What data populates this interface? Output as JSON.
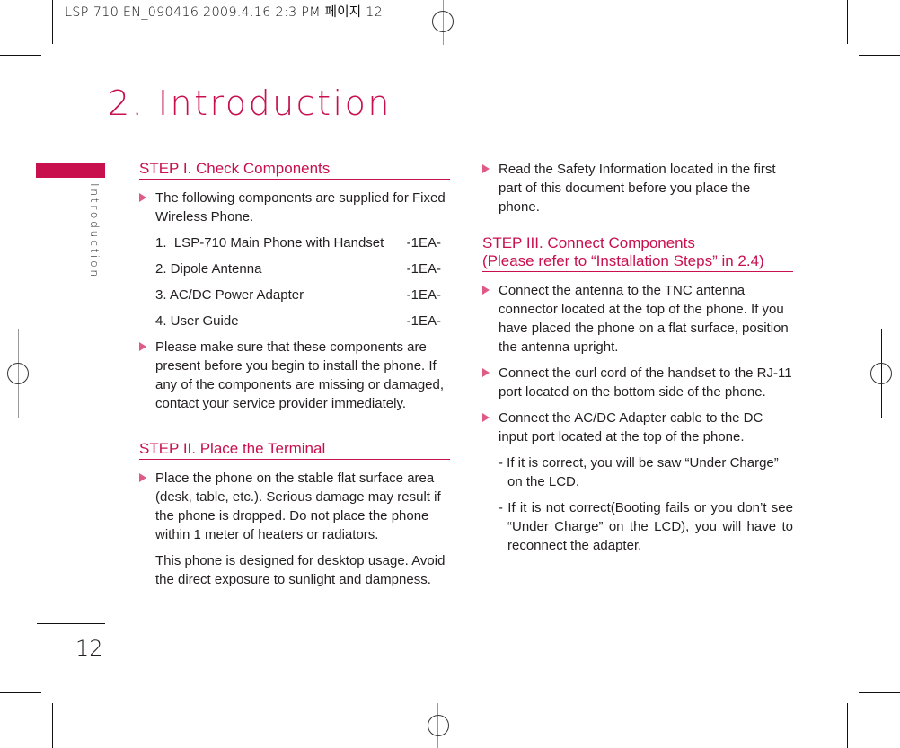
{
  "print_header": "LSP-710 EN_090416  2009.4.16 2:3 PM  페이지 12",
  "chapter": {
    "title": "2. Introduction",
    "side_label": "Introduction",
    "page_number": "12"
  },
  "colors": {
    "accent": "#c8104e",
    "bullet": "#e05a86",
    "text": "#231f20"
  },
  "step1": {
    "heading": "STEP I. Check Components",
    "intro": "The following components are supplied for Fixed Wireless Phone.",
    "items": [
      {
        "name": "1.  LSP-710 Main Phone with Handset",
        "qty": "-1EA-"
      },
      {
        "name": "2. Dipole Antenna",
        "qty": "-1EA-"
      },
      {
        "name": "3. AC/DC Power Adapter",
        "qty": "-1EA-"
      },
      {
        "name": "4. User Guide",
        "qty": "-1EA-"
      }
    ],
    "note": "Please make sure that these components are present before you begin to install the phone. If any of the components are missing or damaged, contact your service provider immediately."
  },
  "step2": {
    "heading": "STEP II.  Place the Terminal",
    "bullet": "Place the phone on the stable flat surface area (desk, table, etc.). Serious damage may result if the phone is dropped. Do not place the phone within 1 meter of heaters or radiators.",
    "para": "This phone is designed for desktop usage. Avoid the direct exposure to  sunlight and dampness.",
    "bullet2": "Read the Safety Information located in the first part of this  document before you place the phone."
  },
  "step3": {
    "heading_line1": "STEP III.  Connect Components",
    "heading_line2": "(Please refer to “Installation Steps” in 2.4)",
    "bullets": [
      "Connect the antenna to the TNC antenna connector located at the top of the phone. If you have placed the phone on a flat surface, position the  antenna upright.",
      "Connect the curl cord of the handset to the RJ-11 port located on the  bottom side of the phone.",
      "Connect the AC/DC Adapter cable to the DC input port located at the top of the phone."
    ],
    "sub_notes": [
      "- If it is correct, you will be saw “Under Charge” on the LCD.",
      "- If it is not correct(Booting fails or you don’t see “Under Charge” on the LCD), you will have to reconnect the adapter."
    ]
  }
}
